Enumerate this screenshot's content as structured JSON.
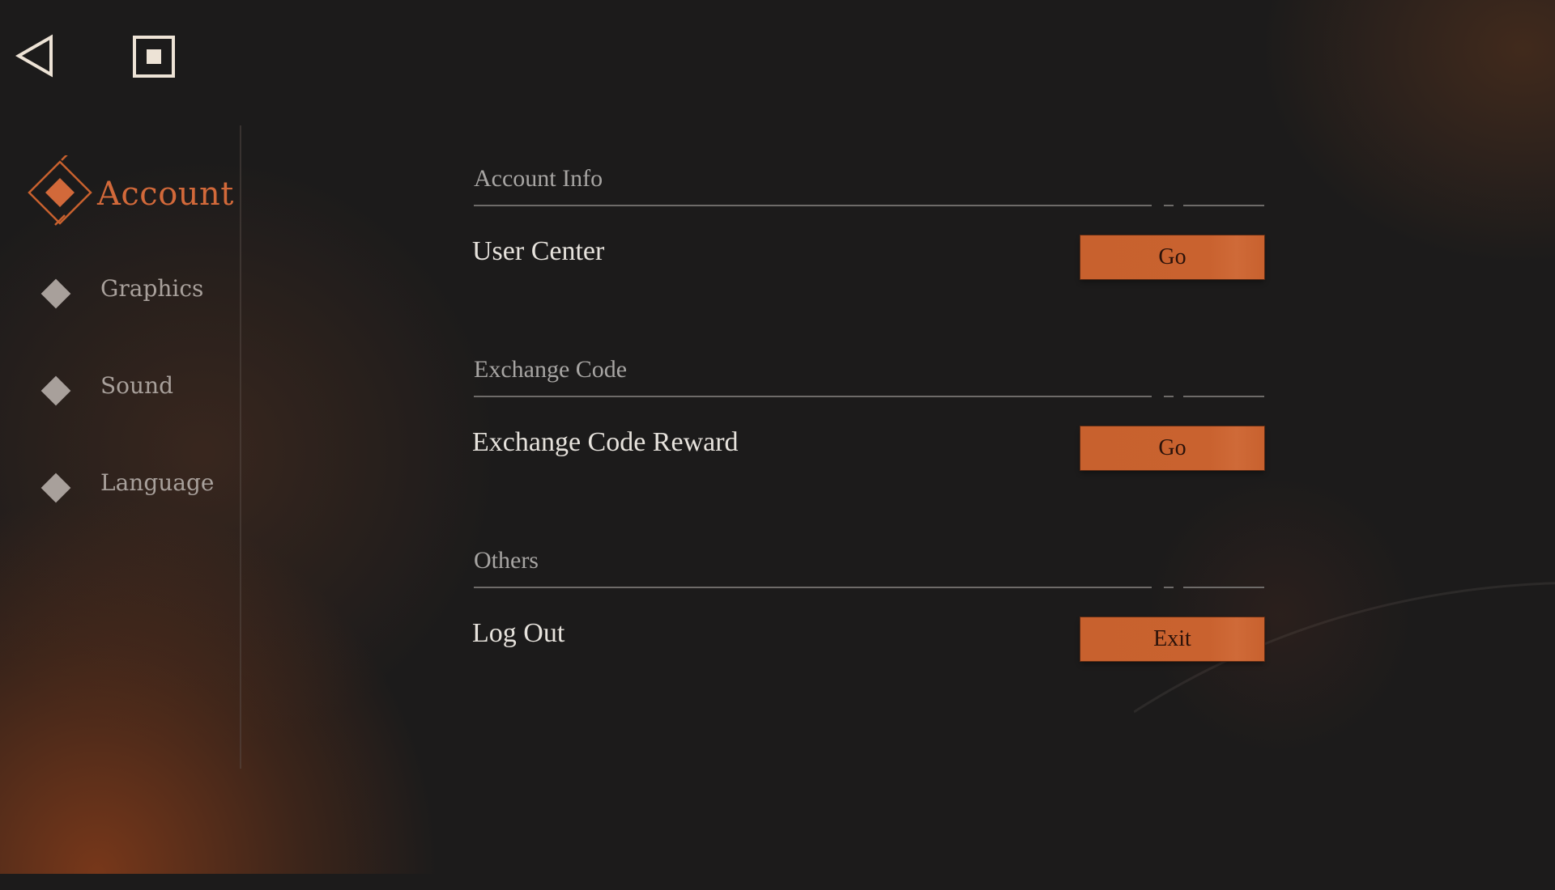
{
  "top_bar": {
    "back_icon": "back-triangle-icon",
    "stop_icon": "stop-square-icon"
  },
  "sidebar": {
    "active": {
      "label": "Account",
      "icon": "orange-diamond-icon"
    },
    "items": [
      {
        "label": "Graphics",
        "icon": "diamond-icon"
      },
      {
        "label": "Sound",
        "icon": "diamond-icon"
      },
      {
        "label": "Language",
        "icon": "diamond-icon"
      }
    ]
  },
  "sections": [
    {
      "title": "Account Info",
      "row_label": "User Center",
      "button_label": "Go"
    },
    {
      "title": "Exchange Code",
      "row_label": "Exchange Code Reward",
      "button_label": "Go"
    },
    {
      "title": "Others",
      "row_label": "Log Out",
      "button_label": "Exit"
    }
  ],
  "colors": {
    "accent": "#c8612e",
    "background": "#1c1b1b",
    "inactive_text": "#a8a09b",
    "active_text": "#d2693a"
  }
}
